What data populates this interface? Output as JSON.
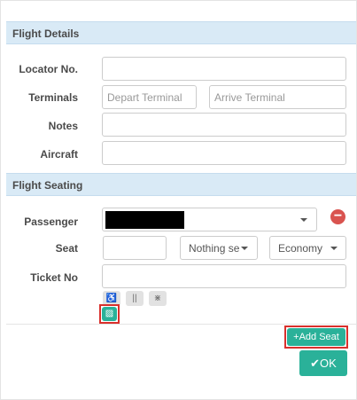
{
  "flight_details": {
    "header": "Flight Details",
    "locator_label": "Locator No.",
    "locator_value": "",
    "terminals_label": "Terminals",
    "depart_placeholder": "Depart Terminal",
    "arrive_placeholder": "Arrive Terminal",
    "notes_label": "Notes",
    "notes_value": "",
    "aircraft_label": "Aircraft",
    "aircraft_value": ""
  },
  "flight_seating": {
    "header": "Flight Seating",
    "passenger_label": "Passenger",
    "seat_label": "Seat",
    "seat_value": "",
    "seat_preference_selected": "Nothing se",
    "cabin_class_selected": "Economy",
    "ticket_label": "Ticket No",
    "ticket_value": "",
    "option_icons": [
      "wheelchair-icon",
      "meal-icon",
      "accessibility-icon",
      "car-icon"
    ]
  },
  "actions": {
    "add_seat_label": "Add Seat",
    "ok_label": "OK"
  },
  "colors": {
    "section_header_bg": "#d9eaf6",
    "primary": "#2ab199",
    "danger": "#d9534f",
    "highlight": "#d9302c"
  }
}
